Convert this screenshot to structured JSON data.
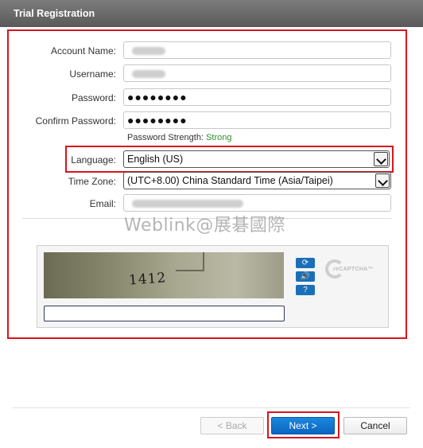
{
  "window": {
    "title": "Trial Registration"
  },
  "form": {
    "account_name_label": "Account Name:",
    "username_label": "Username:",
    "password_label": "Password:",
    "confirm_password_label": "Confirm Password:",
    "password_value": "●●●●●●●●",
    "confirm_password_value": "●●●●●●●●",
    "password_strength_label": "Password Strength:",
    "password_strength_value": "Strong",
    "language_label": "Language:",
    "language_value": "English (US)",
    "timezone_label": "Time Zone:",
    "timezone_value": "(UTC+8.00) China Standard Time (Asia/Taipei)",
    "email_label": "Email:"
  },
  "watermark": "Weblink@展碁國際",
  "captcha": {
    "challenge_text": "1412",
    "brand": "reCAPTCHA™"
  },
  "buttons": {
    "back": "< Back",
    "next": "Next >",
    "cancel": "Cancel"
  },
  "colors": {
    "highlight": "#d9141c",
    "primary": "#0a66bd",
    "strength": "#2f8f2f"
  }
}
